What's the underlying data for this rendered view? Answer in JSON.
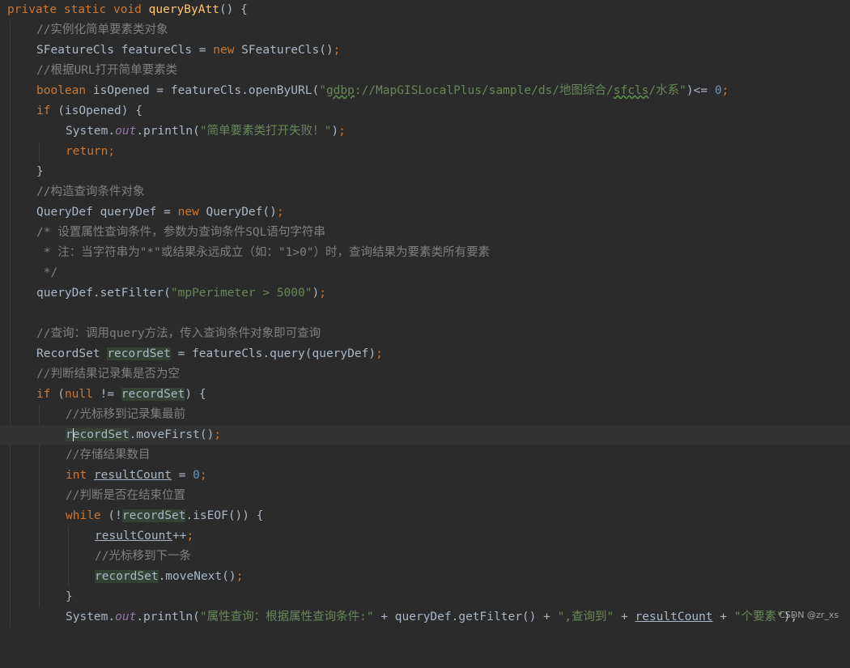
{
  "editor": {
    "theme_colors": {
      "background": "#2b2b2b",
      "keyword": "#cc7832",
      "method_decl": "#ffc66d",
      "string": "#6a8759",
      "number": "#6897bb",
      "comment": "#808080",
      "static_field": "#9876aa",
      "default_text": "#a9b7c6",
      "usage_highlight": "#344134"
    },
    "code": {
      "l1": {
        "kw_private": "private",
        "kw_static": "static",
        "kw_void": "void",
        "method": "queryByAtt",
        "rest": "() {"
      },
      "l2": {
        "comment": "//实例化简单要素类对象"
      },
      "l3": {
        "type": "SFeatureCls featureCls = ",
        "kw_new": "new",
        "rest": " SFeatureCls()",
        "semi": ";"
      },
      "l4": {
        "comment": "//根据URL打开简单要素类"
      },
      "l5": {
        "kw_boolean": "boolean",
        "p1": " isOpened = featureCls.openByURL(",
        "q1": "\"",
        "s_gdbp": "gdbp",
        "s_mid": "://MapGISLocalPlus/sample/ds/地图综合/",
        "s_sfcls": "sfcls",
        "s_end": "/水系\"",
        "p2": ")<= ",
        "num": "0",
        "semi": ";"
      },
      "l6": {
        "kw_if": "if",
        "rest": " (isOpened) {"
      },
      "l7": {
        "p1": "System.",
        "field": "out",
        "p2": ".println(",
        "str": "\"简单要素类打开失败！\"",
        "p3": ")",
        "semi": ";"
      },
      "l8": {
        "kw_return": "return",
        "semi": ";"
      },
      "l9": {
        "rest": "}"
      },
      "l10": {
        "comment": "//构造查询条件对象"
      },
      "l11": {
        "type": "QueryDef queryDef = ",
        "kw_new": "new",
        "rest": " QueryDef()",
        "semi": ";"
      },
      "l12": {
        "comment": "/* 设置属性查询条件，参数为查询条件SQL语句字符串"
      },
      "l13": {
        "comment": " * 注：当字符串为\"*\"或结果永远成立（如：\"1>0\"）时，查询结果为要素类所有要素"
      },
      "l14": {
        "comment": " */"
      },
      "l15": {
        "p1": "queryDef.setFilter(",
        "str": "\"mpPerimeter > 5000\"",
        "p2": ")",
        "semi": ";"
      },
      "l16": {
        "comment": "//查询：调用query方法，传入查询条件对象即可查询"
      },
      "l17": {
        "p1": "RecordSet ",
        "var": "recordSet",
        "p2": " = featureCls.query(queryDef)",
        "semi": ";"
      },
      "l18": {
        "comment": "//判断结果记录集是否为空"
      },
      "l19": {
        "kw_if": "if",
        "p1": " (",
        "kw_null": "null",
        "p2": " != ",
        "var": "recordSet",
        "p3": ") {"
      },
      "l20": {
        "comment": "//光标移到记录集最前"
      },
      "l21": {
        "var_a": "r",
        "var_b": "ecordSet",
        "p1": ".moveFirst()",
        "semi": ";"
      },
      "l22": {
        "comment": "//存储结果数目"
      },
      "l23": {
        "kw_int": "int",
        "sp": " ",
        "var": "resultCount",
        "p1": " = ",
        "num": "0",
        "semi": ";"
      },
      "l24": {
        "comment": "//判断是否在结束位置"
      },
      "l25": {
        "kw_while": "while",
        "p1": " (!",
        "var": "recordSet",
        "p2": ".isEOF()) {"
      },
      "l26": {
        "var": "resultCount",
        "p1": "++",
        "semi": ";"
      },
      "l27": {
        "comment": "//光标移到下一条"
      },
      "l28": {
        "var": "recordSet",
        "p1": ".moveNext()",
        "semi": ";"
      },
      "l29": {
        "rest": "}"
      },
      "l30": {
        "p1": "System.",
        "field": "out",
        "p2": ".println(",
        "str1": "\"属性查询：根据属性查询条件:\"",
        "p3": " + queryDef.getFilter() + ",
        "str2": "\",查询到\"",
        "p4": " + ",
        "var": "resultCount",
        "p5": " + ",
        "str3": "\"个要素\"",
        "p6": ");"
      }
    }
  },
  "watermark": "CSDN @zr_xs"
}
